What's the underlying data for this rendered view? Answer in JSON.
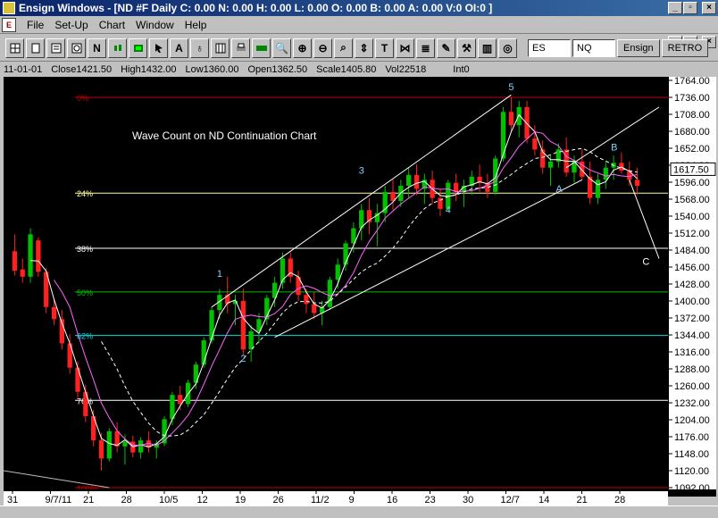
{
  "window": {
    "title": "Ensign Windows - [ND #F Daily C: 0.00 N: 0.00 H: 0.00 L: 0.00 O: 0.00 B: 0.00 A: 0.00 V:0 OI:0 ]"
  },
  "menu": {
    "items": [
      "File",
      "Set-Up",
      "Chart",
      "Window",
      "Help"
    ]
  },
  "toolbar": {
    "symbols": [
      "ES",
      "NQ"
    ],
    "buttons": [
      "Ensign",
      "RETRO"
    ]
  },
  "infobar": {
    "date": "11-01-01",
    "close": "Close1421.50",
    "high": "High1432.00",
    "low": "Low1360.00",
    "open": "Open1362.50",
    "scale": "Scale1405.80",
    "vol": "Vol22518",
    "int": "Int0"
  },
  "chart_data": {
    "type": "candlestick",
    "title": "Wave Count on ND Continuation Chart",
    "price_axis": {
      "min": 1092,
      "max": 1764,
      "step": 28,
      "labels": [
        "1764.00",
        "1736.00",
        "1708.00",
        "1680.00",
        "1652.00",
        "1624.00",
        "1596.00",
        "1568.00",
        "1540.00",
        "1512.00",
        "1484.00",
        "1456.00",
        "1428.00",
        "1400.00",
        "1372.00",
        "1344.00",
        "1316.00",
        "1288.00",
        "1260.00",
        "1232.00",
        "1204.00",
        "1176.00",
        "1148.00",
        "1120.00",
        "1092.00"
      ]
    },
    "current_price": "1617.50",
    "date_labels": [
      "31",
      "9/7/11",
      "21",
      "28",
      "10/5",
      "12",
      "19",
      "26",
      "11/2",
      "9",
      "16",
      "23",
      "30",
      "12/7",
      "14",
      "21",
      "28"
    ],
    "fib_levels": [
      {
        "label": "0%",
        "price": 1736,
        "color": "#c00000"
      },
      {
        "label": "24%",
        "price": 1578,
        "color": "#ffff99"
      },
      {
        "label": "38%",
        "price": 1487,
        "color": "#ffffff"
      },
      {
        "label": "50%",
        "price": 1415,
        "color": "#00c000"
      },
      {
        "label": "62%",
        "price": 1343,
        "color": "#00e0e0"
      },
      {
        "label": "76%",
        "price": 1236,
        "color": "#ffffff"
      },
      {
        "label": "100%",
        "price": 1092,
        "color": "#c00000"
      }
    ],
    "wave_labels": [
      {
        "label": "1",
        "color": "#7fd0ff"
      },
      {
        "label": "2",
        "color": "#7fd0ff"
      },
      {
        "label": "3",
        "color": "#7fd0ff"
      },
      {
        "label": "4",
        "color": "#7fd0ff"
      },
      {
        "label": "5",
        "color": "#7fd0ff"
      },
      {
        "label": "A",
        "color": "#7fd0ff"
      },
      {
        "label": "B",
        "color": "#7fd0ff"
      },
      {
        "label": "C",
        "color": "#ffffff"
      }
    ],
    "bars": [
      [
        1482,
        1510,
        1442,
        1450
      ],
      [
        1452,
        1470,
        1430,
        1440
      ],
      [
        1440,
        1520,
        1430,
        1510
      ],
      [
        1500,
        1505,
        1440,
        1448
      ],
      [
        1448,
        1455,
        1380,
        1390
      ],
      [
        1390,
        1405,
        1360,
        1370
      ],
      [
        1370,
        1385,
        1320,
        1330
      ],
      [
        1330,
        1345,
        1280,
        1290
      ],
      [
        1290,
        1300,
        1240,
        1250
      ],
      [
        1250,
        1262,
        1200,
        1210
      ],
      [
        1210,
        1220,
        1160,
        1170
      ],
      [
        1170,
        1182,
        1120,
        1140
      ],
      [
        1140,
        1190,
        1135,
        1185
      ],
      [
        1185,
        1200,
        1150,
        1160
      ],
      [
        1160,
        1180,
        1130,
        1168
      ],
      [
        1168,
        1178,
        1142,
        1150
      ],
      [
        1150,
        1175,
        1140,
        1170
      ],
      [
        1170,
        1185,
        1150,
        1158
      ],
      [
        1158,
        1170,
        1140,
        1165
      ],
      [
        1165,
        1210,
        1160,
        1205
      ],
      [
        1205,
        1250,
        1195,
        1245
      ],
      [
        1245,
        1260,
        1220,
        1230
      ],
      [
        1230,
        1270,
        1225,
        1265
      ],
      [
        1265,
        1300,
        1255,
        1295
      ],
      [
        1295,
        1340,
        1290,
        1335
      ],
      [
        1335,
        1390,
        1330,
        1385
      ],
      [
        1385,
        1420,
        1370,
        1410
      ],
      [
        1410,
        1440,
        1380,
        1395
      ],
      [
        1395,
        1410,
        1360,
        1400
      ],
      [
        1400,
        1420,
        1310,
        1320
      ],
      [
        1320,
        1360,
        1300,
        1350
      ],
      [
        1350,
        1380,
        1330,
        1370
      ],
      [
        1370,
        1410,
        1360,
        1405
      ],
      [
        1405,
        1440,
        1390,
        1430
      ],
      [
        1430,
        1480,
        1420,
        1470
      ],
      [
        1470,
        1480,
        1430,
        1440
      ],
      [
        1440,
        1450,
        1400,
        1410
      ],
      [
        1410,
        1420,
        1380,
        1395
      ],
      [
        1395,
        1415,
        1370,
        1380
      ],
      [
        1380,
        1400,
        1360,
        1390
      ],
      [
        1390,
        1440,
        1385,
        1435
      ],
      [
        1435,
        1470,
        1420,
        1460
      ],
      [
        1460,
        1500,
        1450,
        1495
      ],
      [
        1495,
        1530,
        1480,
        1520
      ],
      [
        1520,
        1560,
        1500,
        1550
      ],
      [
        1550,
        1570,
        1510,
        1530
      ],
      [
        1530,
        1560,
        1490,
        1545
      ],
      [
        1545,
        1590,
        1530,
        1580
      ],
      [
        1580,
        1600,
        1550,
        1565
      ],
      [
        1565,
        1600,
        1555,
        1590
      ],
      [
        1590,
        1620,
        1570,
        1608
      ],
      [
        1608,
        1625,
        1575,
        1585
      ],
      [
        1585,
        1610,
        1560,
        1600
      ],
      [
        1600,
        1615,
        1560,
        1570
      ],
      [
        1570,
        1585,
        1540,
        1552
      ],
      [
        1552,
        1600,
        1548,
        1595
      ],
      [
        1595,
        1610,
        1565,
        1580
      ],
      [
        1580,
        1600,
        1555,
        1590
      ],
      [
        1590,
        1615,
        1575,
        1605
      ],
      [
        1605,
        1625,
        1580,
        1595
      ],
      [
        1595,
        1610,
        1570,
        1580
      ],
      [
        1580,
        1640,
        1575,
        1635
      ],
      [
        1635,
        1720,
        1630,
        1712
      ],
      [
        1712,
        1736,
        1680,
        1690
      ],
      [
        1690,
        1730,
        1670,
        1720
      ],
      [
        1720,
        1730,
        1660,
        1668
      ],
      [
        1668,
        1690,
        1640,
        1650
      ],
      [
        1650,
        1665,
        1610,
        1620
      ],
      [
        1620,
        1640,
        1590,
        1630
      ],
      [
        1630,
        1660,
        1620,
        1650
      ],
      [
        1650,
        1670,
        1605,
        1612
      ],
      [
        1612,
        1640,
        1595,
        1630
      ],
      [
        1630,
        1650,
        1600,
        1605
      ],
      [
        1605,
        1630,
        1560,
        1570
      ],
      [
        1570,
        1610,
        1560,
        1600
      ],
      [
        1600,
        1630,
        1585,
        1620
      ],
      [
        1620,
        1640,
        1600,
        1628
      ],
      [
        1628,
        1645,
        1610,
        1615
      ],
      [
        1615,
        1630,
        1590,
        1600
      ],
      [
        1600,
        1620,
        1575,
        1590
      ]
    ]
  }
}
